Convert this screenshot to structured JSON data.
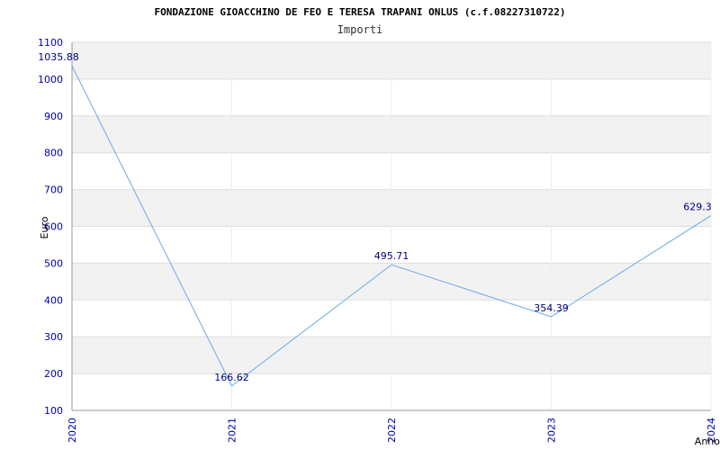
{
  "chart_data": {
    "type": "line",
    "title": "FONDAZIONE GIOACCHINO DE FEO E TERESA TRAPANI ONLUS (c.f.08227310722)",
    "subtitle": "Importi",
    "xlabel": "Anno",
    "ylabel": "Euro",
    "categories": [
      "2020",
      "2021",
      "2022",
      "2023",
      "2024"
    ],
    "series": [
      {
        "values": [
          1035.88,
          166.62,
          495.71,
          354.39,
          629.3
        ]
      }
    ],
    "data_labels": [
      "1035.88",
      "166.62",
      "495.71",
      "354.39",
      "629.3"
    ],
    "ylim": [
      100,
      1100
    ],
    "yticks": [
      100,
      200,
      300,
      400,
      500,
      600,
      700,
      800,
      900,
      1000,
      1100
    ],
    "grid": true,
    "line_color": "#66aaee",
    "band_color": "#f2f2f2",
    "tick_color": "#0000aa"
  }
}
